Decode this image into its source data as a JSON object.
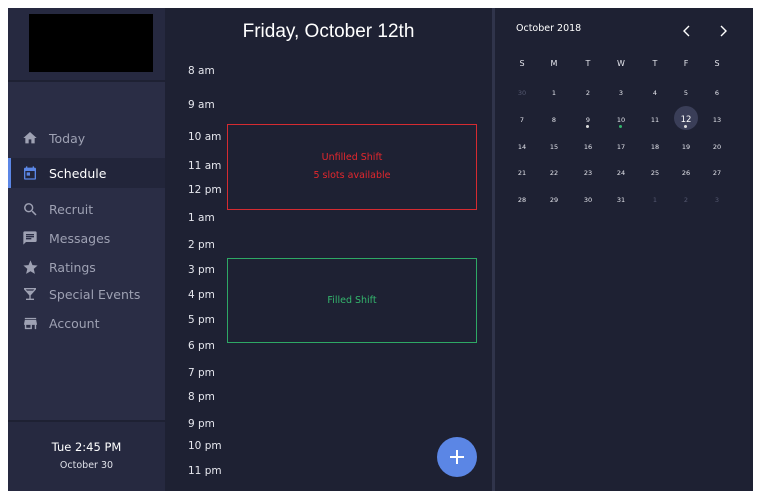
{
  "sidebar": {
    "nav": [
      {
        "label": "Today",
        "icon": "home-icon"
      },
      {
        "label": "Schedule",
        "icon": "calendar-icon",
        "active": true
      },
      {
        "label": "Recruit",
        "icon": "search-icon"
      },
      {
        "label": "Messages",
        "icon": "message-icon"
      },
      {
        "label": "Ratings",
        "icon": "star-icon"
      },
      {
        "label": "Special Events",
        "icon": "cocktail-icon"
      },
      {
        "label": "Account",
        "icon": "store-icon"
      }
    ],
    "datetime": {
      "time": "Tue  2:45 PM",
      "date": "October 30"
    }
  },
  "day_view": {
    "title": "Friday, October 12th",
    "hours": [
      "8 am",
      "9 am",
      "10 am",
      "11 am",
      "12 pm",
      "1 am",
      "2 pm",
      "3 pm",
      "4 pm",
      "5 pm",
      "6 pm",
      "7 pm",
      "8 pm",
      "9 pm",
      "10 pm",
      "11 pm"
    ],
    "unfilled_shift": {
      "title": "Unfilled Shift",
      "subtitle": "5 slots available",
      "color": "#e3272d"
    },
    "filled_shift": {
      "title": "Filled Shift",
      "color": "#34b56d"
    },
    "fab_label": "+"
  },
  "calendar": {
    "month_label": "October 2018",
    "weekdays": [
      "S",
      "M",
      "T",
      "W",
      "T",
      "F",
      "S"
    ],
    "weeks": [
      [
        "30",
        "1",
        "2",
        "3",
        "4",
        "5",
        "6"
      ],
      [
        "7",
        "8",
        "9",
        "10",
        "11",
        "12",
        "13"
      ],
      [
        "14",
        "15",
        "16",
        "17",
        "18",
        "19",
        "20"
      ],
      [
        "21",
        "22",
        "23",
        "24",
        "25",
        "26",
        "27"
      ],
      [
        "28",
        "29",
        "30",
        "31",
        "1",
        "2",
        "3"
      ]
    ],
    "selected_day": "12"
  },
  "colors": {
    "accent": "#5b86e5",
    "unfilled": "#e3272d",
    "filled": "#34b56d"
  }
}
